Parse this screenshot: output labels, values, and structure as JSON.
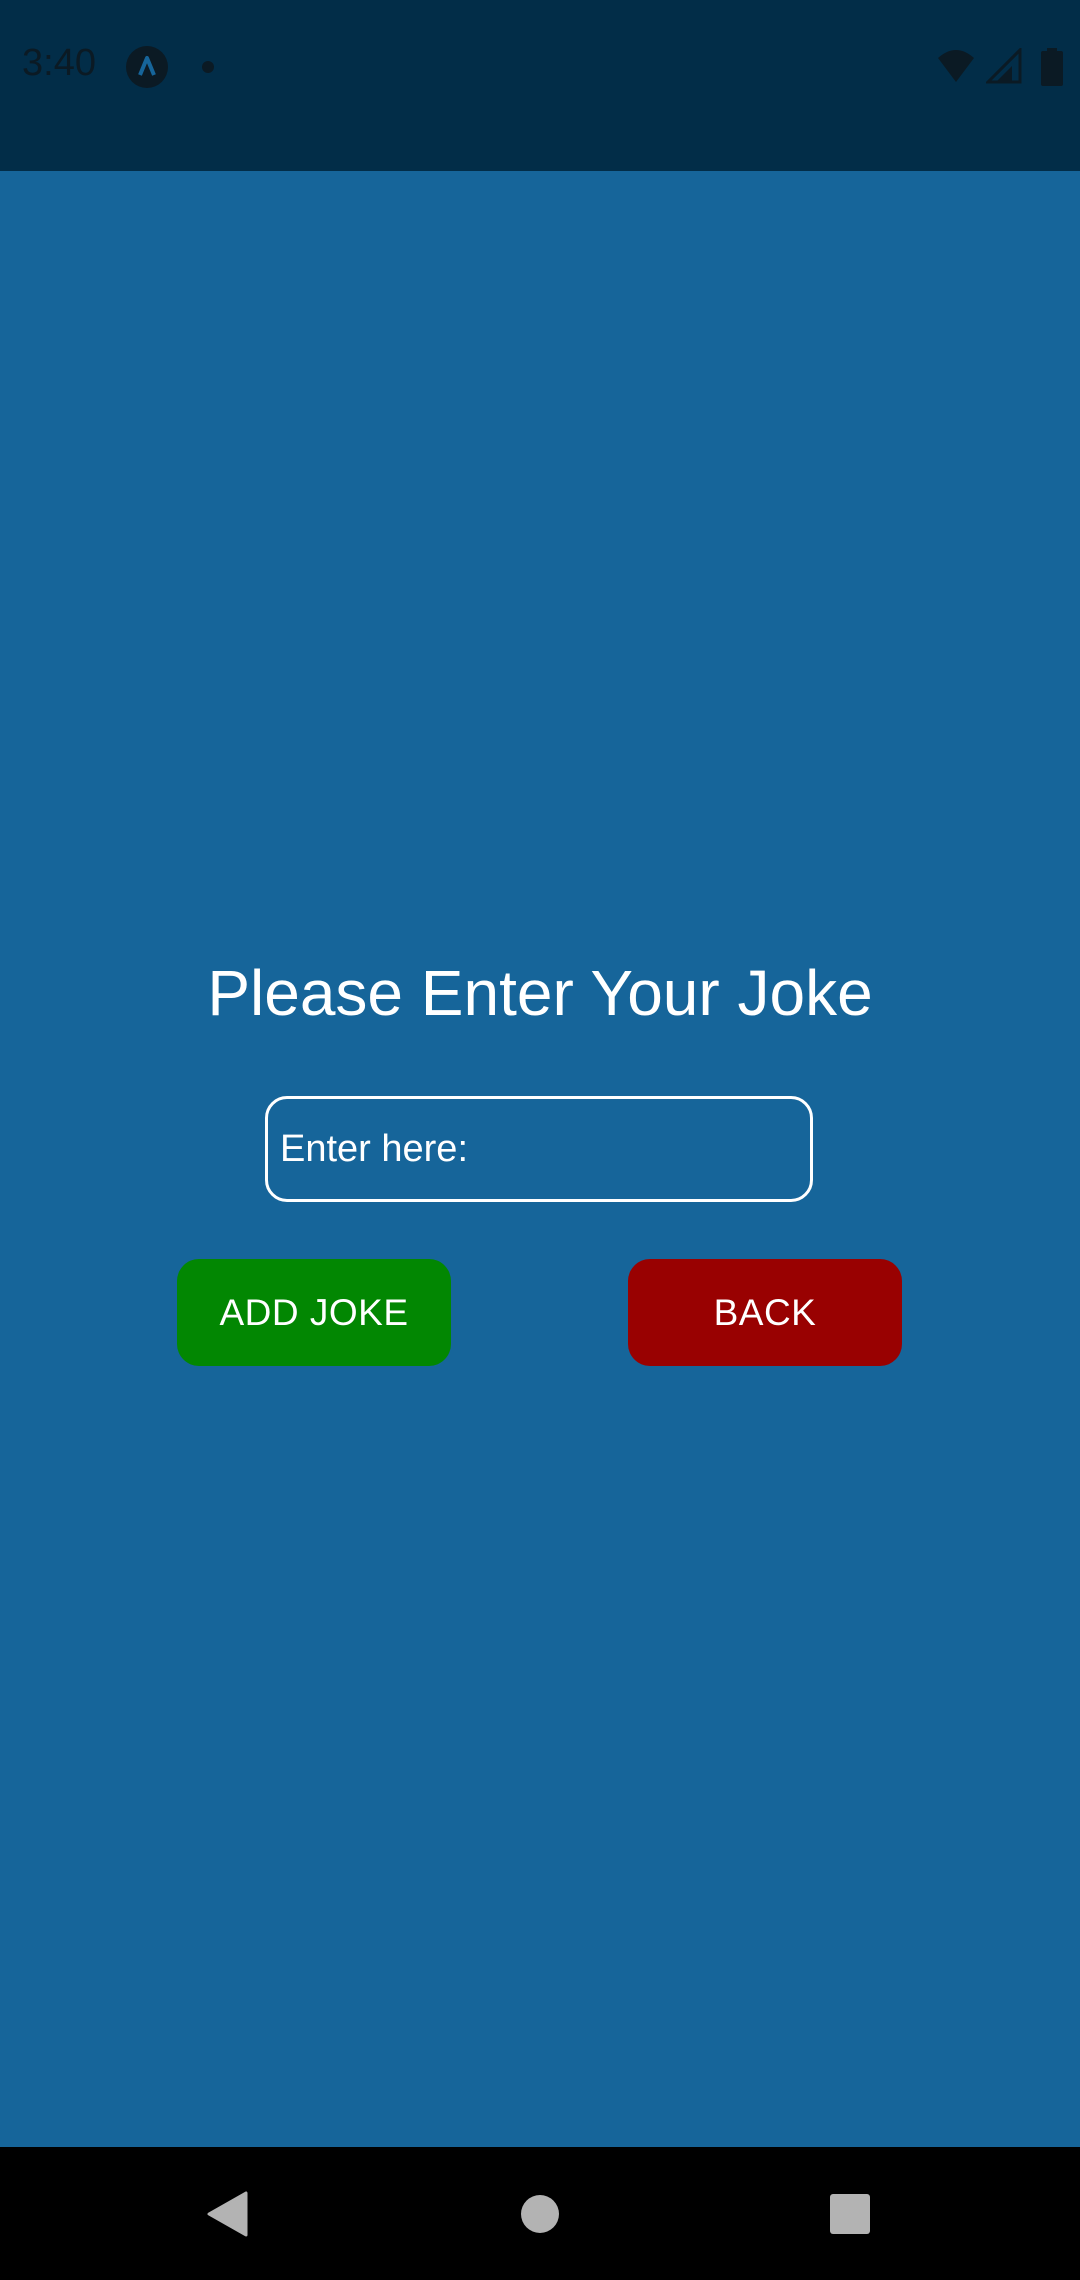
{
  "status_bar": {
    "time": "3:40",
    "icons": [
      "app-indicator-icon",
      "notification-dot-icon",
      "wifi-icon",
      "signal-icon",
      "battery-icon"
    ]
  },
  "main": {
    "title": "Please Enter Your Joke",
    "input": {
      "placeholder": "Enter here:",
      "value": ""
    },
    "buttons": {
      "add_joke": "ADD JOKE",
      "back": "BACK"
    }
  },
  "navigation_bar": {
    "icons": [
      "back-icon",
      "home-icon",
      "recents-icon"
    ]
  },
  "colors": {
    "background": "#16659a",
    "status_bar": "#022d48",
    "add_button": "#028702",
    "back_button": "#990101",
    "text": "#ffffff"
  }
}
